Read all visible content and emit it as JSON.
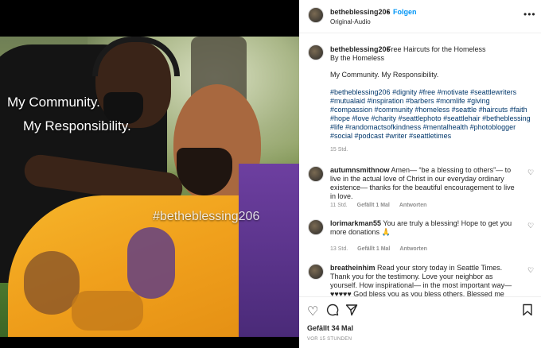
{
  "header": {
    "username": "betheblessing206",
    "separator": "•",
    "follow_label": "Folgen",
    "audio_label": "Original-Audio",
    "more_icon": "more-horizontal-icon"
  },
  "media": {
    "overlay_line1": "My Community.",
    "overlay_line2": "My Responsibility.",
    "overlay_hashtag": "#betheblessing206"
  },
  "caption": {
    "username": "betheblessing206",
    "title": "Free Haircuts for the Homeless",
    "line2": "By the Homeless",
    "line3": "My Community. My Responsibility.",
    "hashtags": "#betheblessing206 #dignity #free #motivate #seattlewriters #mutualaid #inspiration #barbers #momlife #giving #compassion #community #homeless #seattle #haircuts #faith #hope #love #charity #seattlephoto #seattlehair #betheblessing #life #randomactsofkindness #mentalhealth #photoblogger #social #podcast #writer #seattletimes",
    "time": "15 Std."
  },
  "comments": [
    {
      "username": "autumnsmithnow",
      "text": "Amen— “be a blessing to others”— to live in the actual love of Christ in our everyday ordinary existence— thanks for the beautiful encouragement to live in love.",
      "time": "11 Std.",
      "likes": "Gefällt 1 Mal",
      "reply": "Antworten"
    },
    {
      "username": "lorimarkman55",
      "text": "You are truly a blessing! Hope to get you more donations 🙏",
      "time": "13 Std.",
      "likes": "Gefällt 1 Mal",
      "reply": "Antworten"
    },
    {
      "username": "breatheinhim",
      "text": "Read your story today in Seattle Times. Thank you for the testimony. Love your neighbor as yourself. How inspirational— in the most important way— ♥♥♥♥♥ God bless you as you bless others. Blessed me today. ♥♥"
    }
  ],
  "actions": {
    "likes_text": "Gefällt 34 Mal",
    "ago_text": "VOR 15 STUNDEN"
  },
  "colors": {
    "link_blue": "#0095f6",
    "hashtag_blue": "#00376b",
    "cape_gold": "#f0a01c",
    "cape_purple": "#5a3190"
  }
}
